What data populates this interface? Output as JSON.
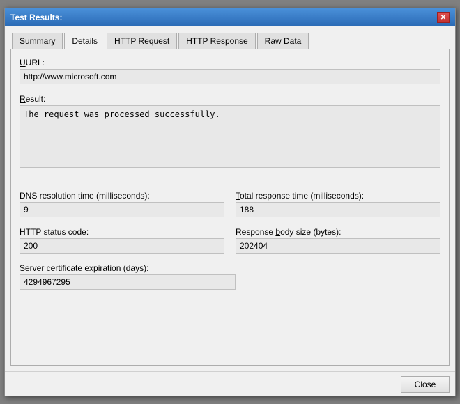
{
  "window": {
    "title": "Test Results:",
    "close_label": "✕"
  },
  "tabs": [
    {
      "label": "Summary",
      "active": false
    },
    {
      "label": "Details",
      "active": true
    },
    {
      "label": "HTTP Request",
      "active": false
    },
    {
      "label": "HTTP Response",
      "active": false
    },
    {
      "label": "Raw Data",
      "active": false
    }
  ],
  "fields": {
    "url_label": "URL:",
    "url_value": "http://www.microsoft.com",
    "result_label": "Result:",
    "result_value": "The request was processed successfully.",
    "dns_label": "DNS resolution time (milliseconds):",
    "dns_value": "9",
    "total_response_label": "Total response time (milliseconds):",
    "total_response_value": "188",
    "http_status_label": "HTTP status code:",
    "http_status_value": "200",
    "response_body_label": "Response body size (bytes):",
    "response_body_value": "202404",
    "cert_expiry_label": "Server certificate expiration (days):",
    "cert_expiry_value": "4294967295"
  },
  "footer": {
    "close_label": "Close"
  }
}
